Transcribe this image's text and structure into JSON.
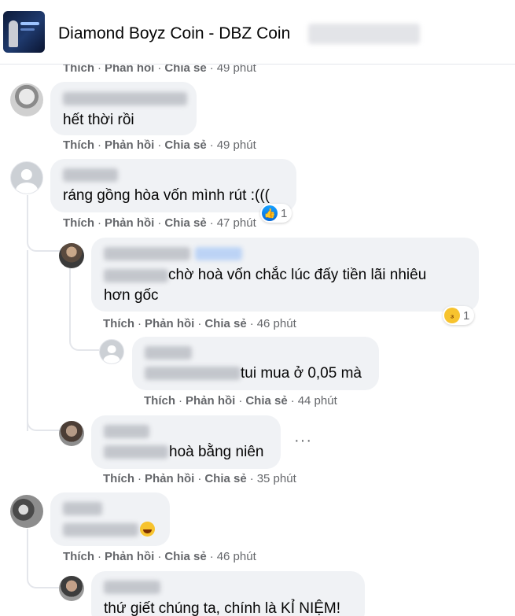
{
  "header": {
    "page_title": "Diamond Boyz Coin - DBZ Coin"
  },
  "actions": {
    "like": "Thích",
    "reply": "Phản hồi",
    "share": "Chia sẻ",
    "dot": "·"
  },
  "comments": [
    {
      "time": "49 phút"
    },
    {
      "text": "hết thời rồi",
      "time": "49 phút"
    },
    {
      "text": "ráng gồng hòa vốn mình rút :(((",
      "time": "47 phút",
      "reaction": {
        "icon": "like-icon",
        "count": "1"
      }
    },
    {
      "text_line1": "chờ hoà vốn chắc lúc đấy tiền lãi nhiêu",
      "text_line2": "hơn gốc",
      "time": "46 phút",
      "reaction": {
        "icon": "haha-icon",
        "count": "1"
      }
    },
    {
      "text": "tui mua ở 0,05 mà",
      "time": "44 phút"
    },
    {
      "text": "hoà bằng niên",
      "time": "35 phút",
      "more": "···"
    },
    {
      "text": "",
      "emoji": "laughing-emoji-icon",
      "time": "46 phút"
    },
    {
      "text": "thứ giết chúng ta, chính là KỈ NIỆM!"
    }
  ]
}
